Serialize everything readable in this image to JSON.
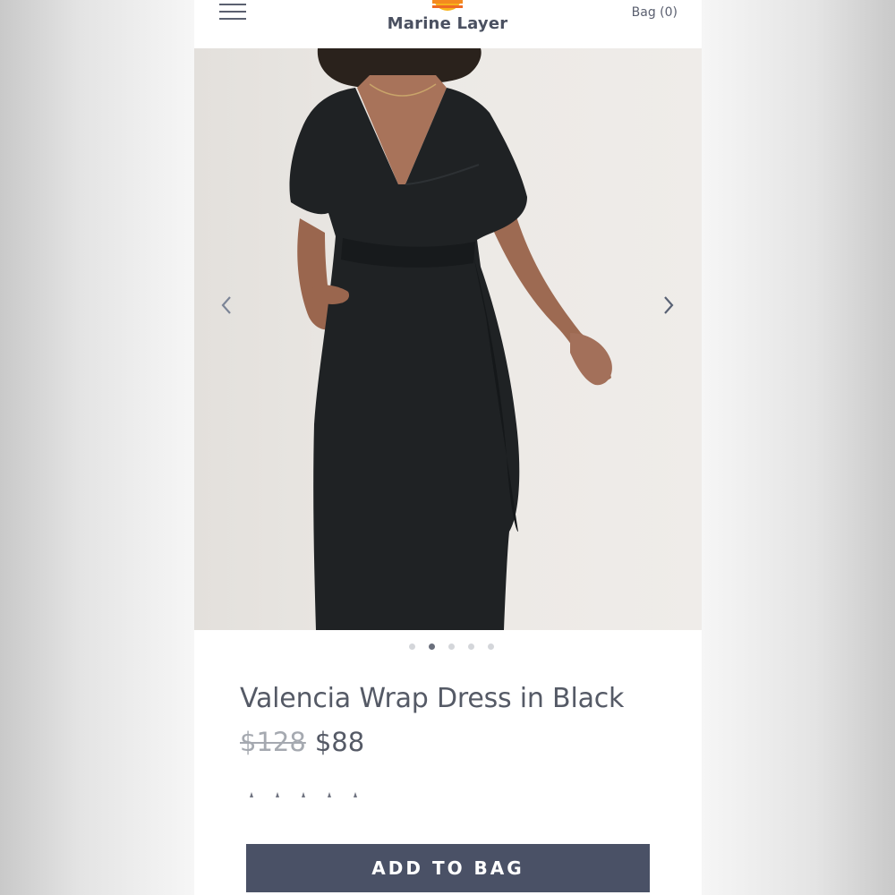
{
  "header": {
    "menu_icon": "hamburger-menu-icon",
    "brand_name": "Marine Layer",
    "bag_label": "Bag (0)"
  },
  "gallery": {
    "prev_icon": "chevron-left-icon",
    "next_icon": "chevron-right-icon",
    "slide_count": 5,
    "active_slide": 2
  },
  "product": {
    "title": "Valencia Wrap Dress in Black",
    "original_price": "$128",
    "sale_price": "$88",
    "color_swatch_count": 5
  },
  "actions": {
    "add_to_bag_label": "ADD TO BAG"
  },
  "colors": {
    "brand_text": "#4a5060",
    "button_bg": "#4a5166",
    "dress": "#1f2224"
  }
}
